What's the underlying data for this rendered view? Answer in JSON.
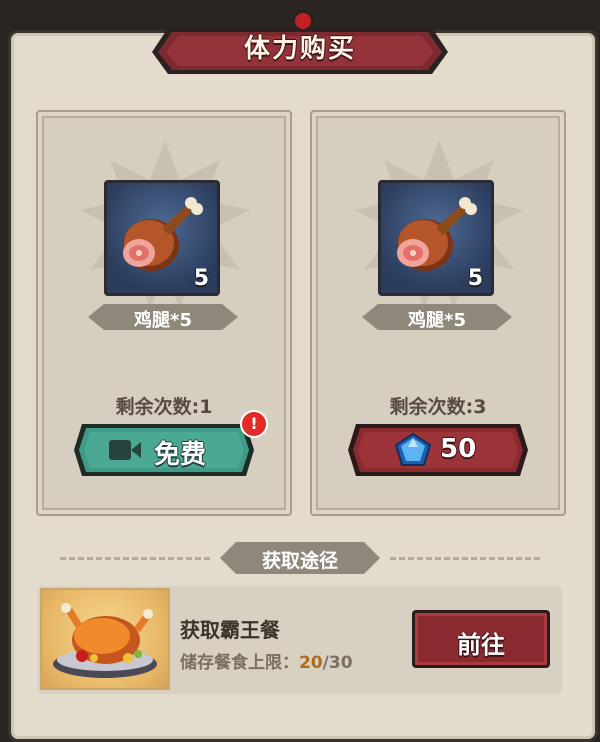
{
  "dialog": {
    "title": "体力购买"
  },
  "offers": [
    {
      "item_name": "鸡腿*5",
      "item_count": "5",
      "remaining_label": "剩余次数:",
      "remaining_value": "1",
      "button_label": "免费",
      "button_icon": "video-icon",
      "has_notification": true,
      "notification_mark": "!"
    },
    {
      "item_name": "鸡腿*5",
      "item_count": "5",
      "remaining_label": "剩余次数:",
      "remaining_value": "3",
      "button_label": "50",
      "button_icon": "diamond-icon"
    }
  ],
  "acquire": {
    "section_title": "获取途径",
    "source": {
      "title": "获取霸王餐",
      "storage_label": "储存餐食上限：",
      "storage_current": "20",
      "storage_separator": "/",
      "storage_max": "30",
      "go_button": "前往",
      "image_icon": "roast-chicken-icon"
    }
  },
  "colors": {
    "free_button": "#3f9a86",
    "paid_button": "#8a2a2f",
    "panel": "#e3dccd"
  }
}
